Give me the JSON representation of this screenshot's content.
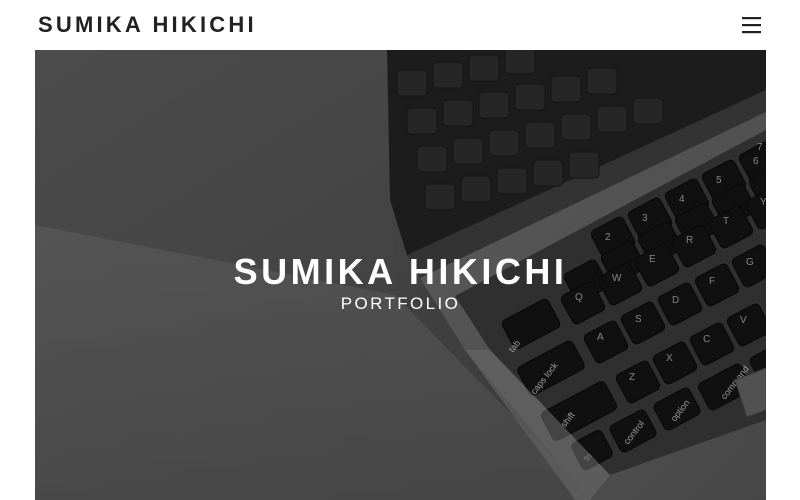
{
  "header": {
    "logo": "SUMIKA HIKICHI",
    "menu_icon": "hamburger-menu-icon"
  },
  "hero": {
    "title": "SUMIKA HIKICHI",
    "subtitle": "PORTFOLIO",
    "image": "laptop-keyboard-photo",
    "key_labels": [
      "tab",
      "caps lock",
      "shift",
      "fn",
      "control",
      "option",
      "command",
      "A",
      "S",
      "D",
      "F",
      "G",
      "Q",
      "W",
      "E",
      "R",
      "T",
      "Y",
      "Z",
      "X",
      "C",
      "V",
      "2",
      "3",
      "4",
      "5",
      "6",
      "7"
    ]
  }
}
